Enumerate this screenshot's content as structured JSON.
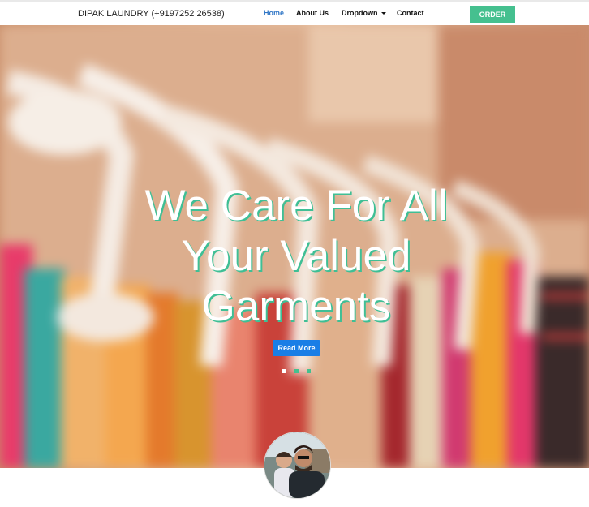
{
  "navbar": {
    "brand": "DIPAK LAUNDRY (+9197252 26538)",
    "links": [
      {
        "label": "Home",
        "active": true
      },
      {
        "label": "About Us",
        "active": false
      },
      {
        "label": "Dropdown",
        "active": false
      },
      {
        "label": "Contact",
        "active": false
      }
    ],
    "order_button": "ORDER"
  },
  "hero": {
    "title_lines": [
      "We Care For All",
      "Your Valued",
      "Garments"
    ],
    "read_more": "Read More",
    "carousel": {
      "slides": 3,
      "active_index": 0
    }
  },
  "colors": {
    "accent": "#45c08f",
    "link_active": "#2f76c6",
    "button_primary": "#1a7ee6",
    "title_shadow": "#3fbf95"
  },
  "icons": {
    "dropdown": "caret-down-icon"
  }
}
